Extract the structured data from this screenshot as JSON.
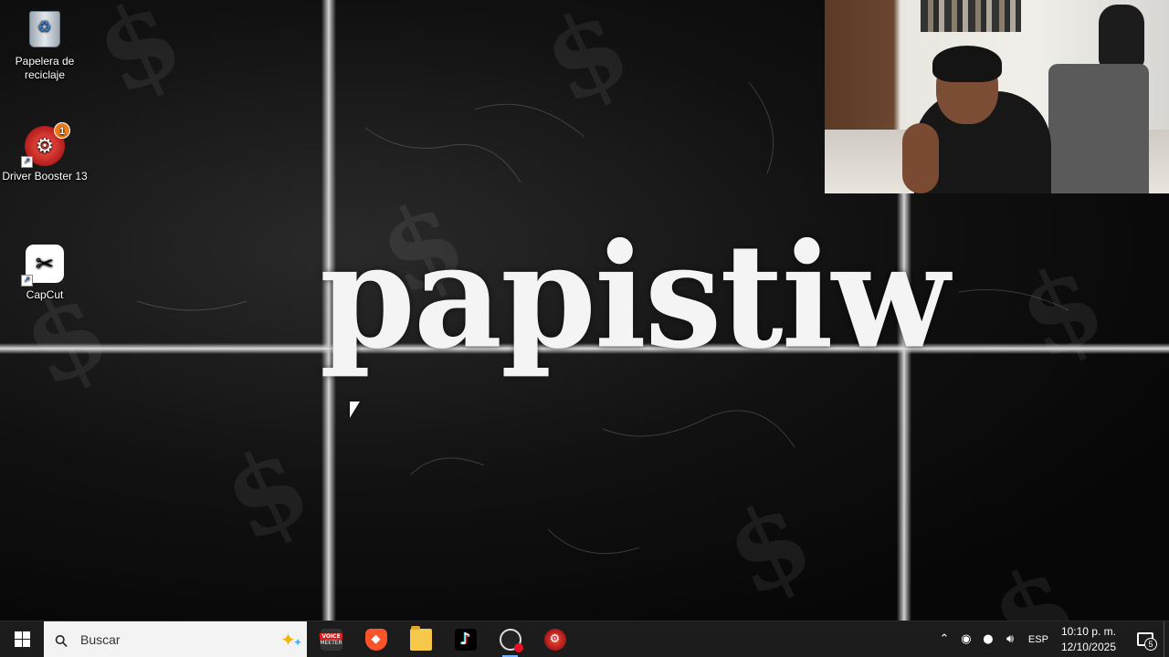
{
  "wallpaper": {
    "title": "papistiw"
  },
  "desktop_icons": [
    {
      "label": "Papelera de reciclaje",
      "icon": "recycle-bin-icon"
    },
    {
      "label": "Driver Booster 13",
      "icon": "driver-booster-icon",
      "badge": "1"
    },
    {
      "label": "CapCut",
      "icon": "capcut-icon"
    }
  ],
  "taskbar": {
    "search_placeholder": "Buscar",
    "apps": [
      {
        "name": "VoiceMeeter",
        "text": "VOICE"
      },
      {
        "name": "Brave"
      },
      {
        "name": "File Explorer"
      },
      {
        "name": "TikTok"
      },
      {
        "name": "OBS Studio"
      },
      {
        "name": "Driver Booster"
      }
    ],
    "tray": {
      "language": "ESP",
      "time": "10:10 p. m.",
      "date": "12/10/2025",
      "notifications": "5"
    }
  },
  "colors": {
    "taskbar_bg": "#1c1c1c",
    "badge": "#f07c1a",
    "recording_dot": "#e81123"
  }
}
